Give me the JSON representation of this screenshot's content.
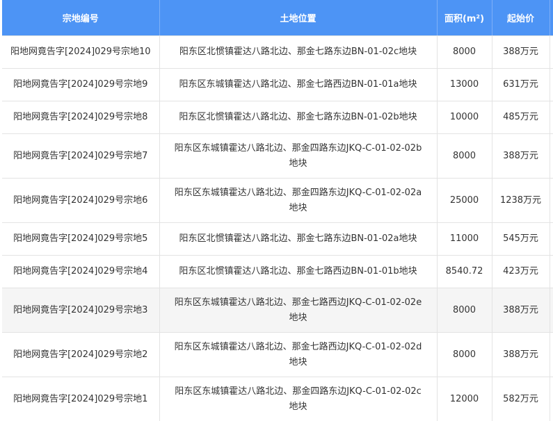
{
  "table": {
    "headers": {
      "id": "宗地编号",
      "location": "土地位置",
      "area": "面积(m²)",
      "price": "起始价"
    },
    "rows": [
      {
        "id": "阳地网竟告字[2024]029号宗地10",
        "location": "阳东区北惯镇霍达八路北边、那金七路东边BN-01-02c地块",
        "area": "8000",
        "price": "388万元"
      },
      {
        "id": "阳地网竟告字[2024]029号宗地9",
        "location": "阳东区东城镇霍达八路北边、那金七路西边BN-01-01a地块",
        "area": "13000",
        "price": "631万元"
      },
      {
        "id": "阳地网竟告字[2024]029号宗地8",
        "location": "阳东区北惯镇霍达八路北边、那金七路东边BN-01-02b地块",
        "area": "10000",
        "price": "485万元"
      },
      {
        "id": "阳地网竟告字[2024]029号宗地7",
        "location": "阳东区东城镇霍达八路北边、那金四路东边JKQ-C-01-02-02b地块",
        "area": "8000",
        "price": "388万元"
      },
      {
        "id": "阳地网竟告字[2024]029号宗地6",
        "location": "阳东区东城镇霍达八路北边、那金四路东边JKQ-C-01-02-02a地块",
        "area": "25000",
        "price": "1238万元"
      },
      {
        "id": "阳地网竟告字[2024]029号宗地5",
        "location": "阳东区北惯镇霍达八路北边、那金七路东边BN-01-02a地块",
        "area": "11000",
        "price": "545万元"
      },
      {
        "id": "阳地网竟告字[2024]029号宗地4",
        "location": "阳东区北惯镇霍达八路北边、那金七路西边BN-01-01b地块",
        "area": "8540.72",
        "price": "423万元"
      },
      {
        "id": "阳地网竟告字[2024]029号宗地3",
        "location": "阳东区东城镇霍达八路北边、那金七路西边JKQ-C-01-02-02e地块",
        "area": "8000",
        "price": "388万元"
      },
      {
        "id": "阳地网竟告字[2024]029号宗地2",
        "location": "阳东区东城镇霍达八路北边、那金七路西边JKQ-C-01-02-02d地块",
        "area": "8000",
        "price": "388万元"
      },
      {
        "id": "阳地网竟告字[2024]029号宗地1",
        "location": "阳东区东城镇霍达八路北边、那金四路东边JKQ-C-01-02-02c地块",
        "area": "12000",
        "price": "582万元"
      }
    ]
  }
}
